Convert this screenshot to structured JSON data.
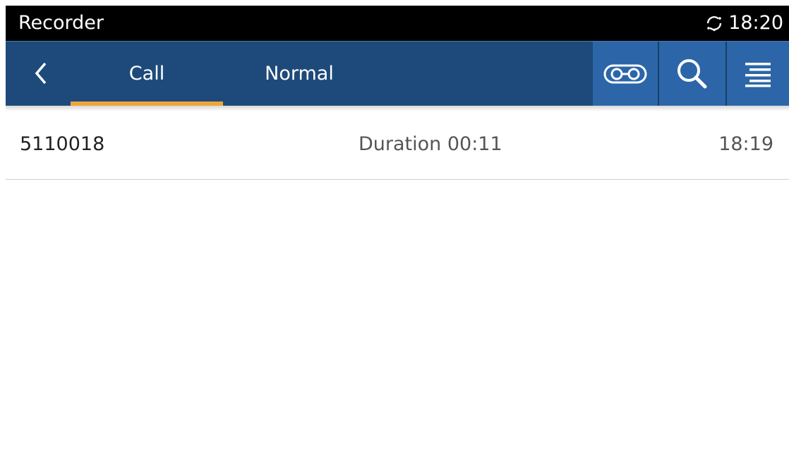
{
  "status_bar": {
    "title": "Recorder",
    "time": "18:20",
    "icons": [
      "sync-icon"
    ]
  },
  "toolbar": {
    "back_icon": "chevron-left-icon",
    "tabs": [
      {
        "label": "Call",
        "active": true
      },
      {
        "label": "Normal",
        "active": false
      }
    ],
    "actions": [
      "record-icon",
      "search-icon",
      "menu-icon"
    ]
  },
  "recordings": [
    {
      "number": "5110018",
      "duration": "Duration 00:11",
      "time": "18:19"
    }
  ],
  "colors": {
    "status_bar": "#000000",
    "toolbar": "#1d4a7a",
    "action_button": "#2c66a8",
    "tab_indicator": "#f0a53a"
  }
}
